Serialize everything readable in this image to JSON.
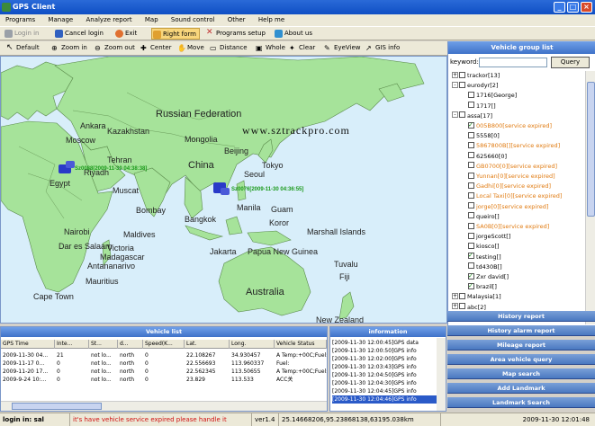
{
  "window": {
    "title": "GPS Client",
    "minimize": "_",
    "maximize": "□",
    "close": "×"
  },
  "menu": [
    "Programs",
    "Manage",
    "Analyze report",
    "Map",
    "Sound control",
    "Other",
    "Help me"
  ],
  "toolbar1": [
    {
      "label": "Login in",
      "color": "#9aa0a8"
    },
    {
      "label": "Cancel login",
      "color": "#3060c0"
    },
    {
      "label": "Exit",
      "color": "#e07030"
    },
    {
      "label": "Right form",
      "color": "#e0a030",
      "active": true
    },
    {
      "label": "Programs setup",
      "color": "#c03030"
    },
    {
      "label": "About us",
      "color": "#3090d0"
    }
  ],
  "toolbar2": [
    "Default",
    "Zoom in",
    "Zoom out",
    "Center",
    "Move",
    "Distance",
    "Whole",
    "Clear",
    "EyeView",
    "GIS info"
  ],
  "map": {
    "watermark": "www.sztrackpro.com",
    "labels": [
      {
        "t": "Russian Federation",
        "big": true
      },
      {
        "t": "Kazakhstan"
      },
      {
        "t": "Mongolia"
      },
      {
        "t": "China"
      },
      {
        "t": "Egypt"
      },
      {
        "t": "Muscat"
      },
      {
        "t": "Bombay"
      },
      {
        "t": "Bangkok"
      },
      {
        "t": "Manila"
      },
      {
        "t": "Guam"
      },
      {
        "t": "Koror"
      },
      {
        "t": "Marshall Islands"
      },
      {
        "t": "Jakarta"
      },
      {
        "t": "Papua New Guinea"
      },
      {
        "t": "Tuvalu"
      },
      {
        "t": "Fiji"
      },
      {
        "t": "Australia",
        "big": true
      },
      {
        "t": "New Zealand"
      },
      {
        "t": "Maldives"
      },
      {
        "t": "Victoria"
      },
      {
        "t": "Mauritius"
      },
      {
        "t": "Moscow"
      },
      {
        "t": "Tehran"
      },
      {
        "t": "Beijing"
      },
      {
        "t": "Tokyo"
      },
      {
        "t": "Seoul"
      },
      {
        "t": "Riyadh"
      },
      {
        "t": "Nairobi"
      },
      {
        "t": "Dar es Salaam"
      },
      {
        "t": "Antananarivo"
      },
      {
        "t": "Cape Town"
      },
      {
        "t": "Madagascar"
      },
      {
        "t": "Ankara"
      }
    ],
    "markers": [
      {
        "label": "Sz0088[2009-11-30 04:38:38]"
      },
      {
        "label": "Sz0076[2009-11-30 04:36:55]"
      }
    ]
  },
  "group_panel": {
    "title": "Vehicle group list",
    "keyword_label": "keyword:",
    "keyword_value": "",
    "query_button": "Query",
    "tree": [
      {
        "text": "trackor[13]",
        "level": 0,
        "expander": "+",
        "cb": false
      },
      {
        "text": "eurodyr[2]",
        "level": 0,
        "expander": "-",
        "cb": false
      },
      {
        "text": "1716[George]",
        "level": 1,
        "cb": false
      },
      {
        "text": "1717[]",
        "level": 1,
        "cb": false
      },
      {
        "text": "assa[17]",
        "level": 0,
        "expander": "-",
        "cb": false
      },
      {
        "text": "005B800[service expired]",
        "level": 1,
        "cb": true,
        "orange": true
      },
      {
        "text": "5558[0]",
        "level": 1,
        "cb": false
      },
      {
        "text": "5867800B[][service expired]",
        "level": 1,
        "cb": false,
        "orange": true
      },
      {
        "text": "625660[0]",
        "level": 1,
        "cb": false
      },
      {
        "text": "GB0700[0][service expired]",
        "level": 1,
        "cb": false,
        "orange": true
      },
      {
        "text": "Yunnan[0][service expired]",
        "level": 1,
        "cb": false,
        "orange": true
      },
      {
        "text": "Gadhi[0][service expired]",
        "level": 1,
        "cb": false,
        "orange": true
      },
      {
        "text": "Local Taxi[0][service expired]",
        "level": 1,
        "cb": false,
        "orange": true
      },
      {
        "text": "jorge[0][service expired]",
        "level": 1,
        "cb": false,
        "orange": true
      },
      {
        "text": "queiro[]",
        "level": 1,
        "cb": false
      },
      {
        "text": "SA0B[0][service expired]",
        "level": 1,
        "cb": false,
        "orange": true
      },
      {
        "text": "jorgeScott[]",
        "level": 1,
        "cb": false
      },
      {
        "text": "kiosco[]",
        "level": 1,
        "cb": false
      },
      {
        "text": "testing[]",
        "level": 1,
        "cb": true
      },
      {
        "text": "td430B[]",
        "level": 1,
        "cb": false
      },
      {
        "text": "Zxr david[]",
        "level": 1,
        "cb": true
      },
      {
        "text": "brazil[]",
        "level": 1,
        "cb": true
      },
      {
        "text": "Malaysia[1]",
        "level": 0,
        "expander": "+",
        "cb": false
      },
      {
        "text": "abc[2]",
        "level": 0,
        "expander": "+",
        "cb": false
      }
    ]
  },
  "accordion": [
    "History report",
    "History alarm report",
    "Mileage report",
    "Area vehicle query",
    "Map search",
    "Add Landmark",
    "Landmark Search"
  ],
  "vehicle_list": {
    "title": "Vehicle list",
    "columns": [
      "GPS Time",
      "Inte...",
      "St...",
      "d...",
      "Speed(K...",
      "Lat.",
      "Long.",
      "Vehicle Status"
    ],
    "rows": [
      [
        "2009-11-30 04...",
        "21",
        "not lo...",
        "north",
        "0",
        "22.108267",
        "34.930457",
        "A Temp:+00C;Fuel:"
      ],
      [
        "2009-11-17 0...",
        "0",
        "not lo...",
        "north",
        "0",
        "22.556693",
        "113.960337",
        "Fuel:"
      ],
      [
        "2009-11-20 17...",
        "0",
        "not lo...",
        "north",
        "0",
        "22.562345",
        "113.50655",
        "A Temp:+00C;Fuel:"
      ],
      [
        "2009-9-24 10:...",
        "0",
        "not lo...",
        "north",
        "0",
        "23.829",
        "113.533",
        "ACC关"
      ]
    ]
  },
  "information": {
    "title": "information",
    "rows": [
      "[2009-11-30 12:00:45]GPS data",
      "[2009-11-30 12:00:50]GPS info",
      "[2009-11-30 12:02:00]GPS info",
      "[2009-11-30 12:03:43]GPS info",
      "[2009-11-30 12:04:50]GPS info",
      "[2009-11-30 12:04:30]GPS info",
      "[2009-11-30 12:04:45]GPS info",
      "[2009-11-30 12:04:46]GPS info"
    ]
  },
  "status": {
    "login": "login in: sal",
    "warning": "it's have vehicle service expired please handle it",
    "version": "ver1.4",
    "coords": "25.14668206,95.23868138,63195.038km",
    "time": "2009-11-30  12:01:48"
  }
}
